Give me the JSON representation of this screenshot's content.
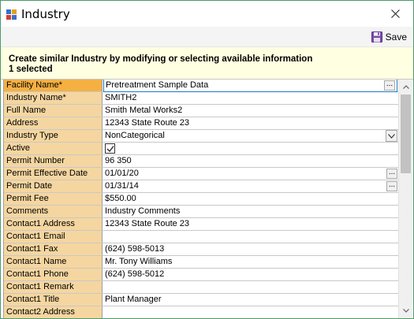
{
  "window": {
    "title": "Industry",
    "accent_border": "#4a9a6a"
  },
  "toolbar": {
    "save_label": "Save"
  },
  "info": {
    "line1": "Create similar Industry by modifying or selecting available information",
    "line2": "1 selected"
  },
  "colors": {
    "label_bg": "#f5d6a0",
    "label_selected_bg": "#f5b042",
    "info_bg": "#ffffe1",
    "focus_border": "#1e7abf"
  },
  "rows": [
    {
      "label": "Facility Name*",
      "value": "Pretreatment Sample Data",
      "editor": "ellipsis",
      "selected": true
    },
    {
      "label": "Industry Name*",
      "value": "SMITH2",
      "editor": "text"
    },
    {
      "label": "Full Name",
      "value": "Smith Metal Works2",
      "editor": "text"
    },
    {
      "label": "Address",
      "value": "12343 State Route 23",
      "editor": "text"
    },
    {
      "label": "Industry Type",
      "value": "NonCategorical",
      "editor": "combo"
    },
    {
      "label": "Active",
      "value": "",
      "editor": "checkbox",
      "checked": true
    },
    {
      "label": "Permit Number",
      "value": "96 350",
      "editor": "text"
    },
    {
      "label": "Permit Effective Date",
      "value": "01/01/20",
      "editor": "ellipsis"
    },
    {
      "label": "Permit Date",
      "value": "01/31/14",
      "editor": "ellipsis"
    },
    {
      "label": "Permit Fee",
      "value": "$550.00",
      "editor": "text"
    },
    {
      "label": "Comments",
      "value": "Industry Comments",
      "editor": "text"
    },
    {
      "label": "Contact1 Address",
      "value": "12343 State Route 23",
      "editor": "text"
    },
    {
      "label": "Contact1 Email",
      "value": "",
      "editor": "text"
    },
    {
      "label": "Contact1 Fax",
      "value": "(624) 598-5013",
      "editor": "text"
    },
    {
      "label": "Contact1 Name",
      "value": "Mr. Tony Williams",
      "editor": "text"
    },
    {
      "label": "Contact1 Phone",
      "value": "(624) 598-5012",
      "editor": "text"
    },
    {
      "label": "Contact1 Remark",
      "value": "",
      "editor": "text"
    },
    {
      "label": "Contact1 Title",
      "value": "Plant Manager",
      "editor": "text"
    },
    {
      "label": "Contact2 Address",
      "value": "",
      "editor": "text"
    }
  ],
  "icons": {
    "app": "app-icon",
    "close": "close-icon",
    "save": "save-disk-icon",
    "ellipsis": "ellipsis-icon",
    "combo": "chevron-down-icon",
    "check": "checkmark-icon",
    "scroll_up": "scroll-up-arrow-icon",
    "scroll_down": "scroll-down-arrow-icon"
  }
}
